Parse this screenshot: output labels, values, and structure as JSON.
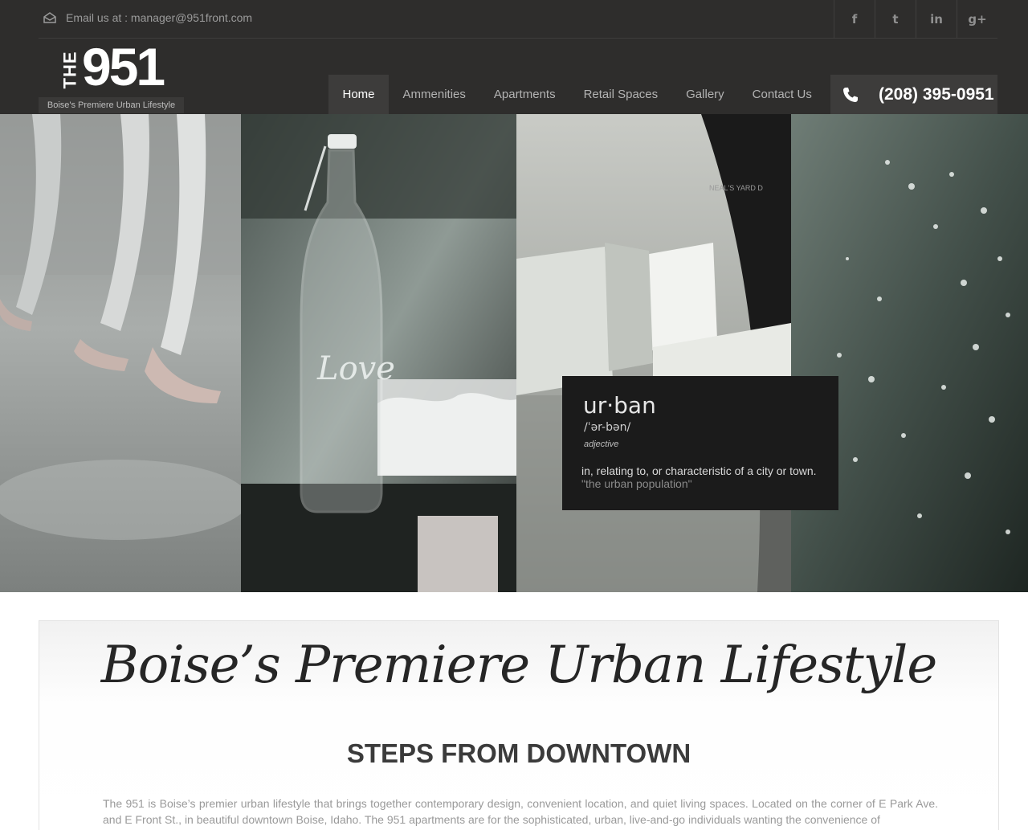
{
  "topbar": {
    "email_text": "Email us at : manager@951front.com",
    "socials": [
      {
        "icon": "facebook-icon",
        "glyph": "f"
      },
      {
        "icon": "twitter-icon",
        "glyph": "t"
      },
      {
        "icon": "linkedin-icon",
        "glyph": "in"
      },
      {
        "icon": "google-plus-icon",
        "glyph": "g+"
      }
    ]
  },
  "logo": {
    "the": "THE",
    "number": "951",
    "tagline": "Boise's Premiere Urban Lifestyle"
  },
  "nav": {
    "items": [
      "Home",
      "Ammenities",
      "Apartments",
      "Retail Spaces",
      "Gallery",
      "Contact Us"
    ],
    "active": "Home"
  },
  "phone": {
    "number": "(208) 395-0951"
  },
  "hero": {
    "definition": {
      "word": "ur·ban",
      "pronunciation": "/ˈər-bən/",
      "part_of_speech": "adjective",
      "meaning": "in, relating to, or characteristic of a city or town.",
      "example": "\"the urban population\""
    },
    "bottle_text": "Love",
    "apron_text": "NEAL'S YARD D"
  },
  "content": {
    "script_title": "Boise’s Premiere Urban Lifestyle",
    "heading": "STEPS FROM DOWNTOWN",
    "paragraph": "The 951 is Boise’s premier urban lifestyle that brings together contemporary design, convenient location, and quiet living spaces. Located on the corner of E Park Ave. and E Front St., in beautiful downtown Boise, Idaho. The 951 apartments are for the sophisticated, urban, live-and-go individuals wanting the convenience of"
  },
  "colors": {
    "header_bg": "#2e2d2c",
    "nav_active_bg": "#3d3c3b",
    "definition_card_bg": "#1b1b1b"
  }
}
